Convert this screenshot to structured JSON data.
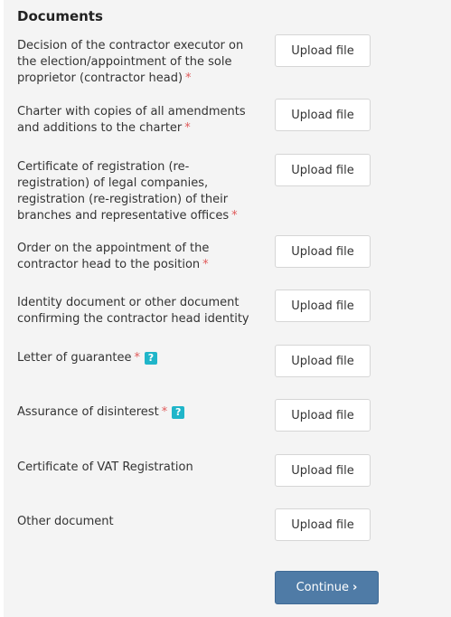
{
  "section": {
    "title": "Documents"
  },
  "documents": [
    {
      "label": "Decision of the contractor executor on the election/appointment of the sole proprietor (contractor head)",
      "required": "*",
      "upload_label": "Upload file"
    },
    {
      "label": "Charter with copies of all amendments and additions to the charter",
      "required": "*",
      "upload_label": "Upload file"
    },
    {
      "label": "Certificate of registration (re-registration) of legal companies, registration (re-registration) of their branches and representative offices",
      "required": "*",
      "upload_label": "Upload file"
    },
    {
      "label": "Order on the appointment of the contractor head to the position",
      "required": "*",
      "upload_label": "Upload file"
    },
    {
      "label": "Identity document or other document confirming the contractor head identity",
      "upload_label": "Upload file"
    },
    {
      "label": "Letter of guarantee",
      "required": "*",
      "help": "?",
      "upload_label": "Upload file"
    },
    {
      "label": "Assurance of disinterest",
      "required": "*",
      "help": "?",
      "upload_label": "Upload file"
    },
    {
      "label": "Certificate of VAT Registration",
      "upload_label": "Upload file"
    },
    {
      "label": "Other document",
      "upload_label": "Upload file"
    }
  ],
  "actions": {
    "continue_label": "Continue",
    "continue_icon": "›"
  }
}
